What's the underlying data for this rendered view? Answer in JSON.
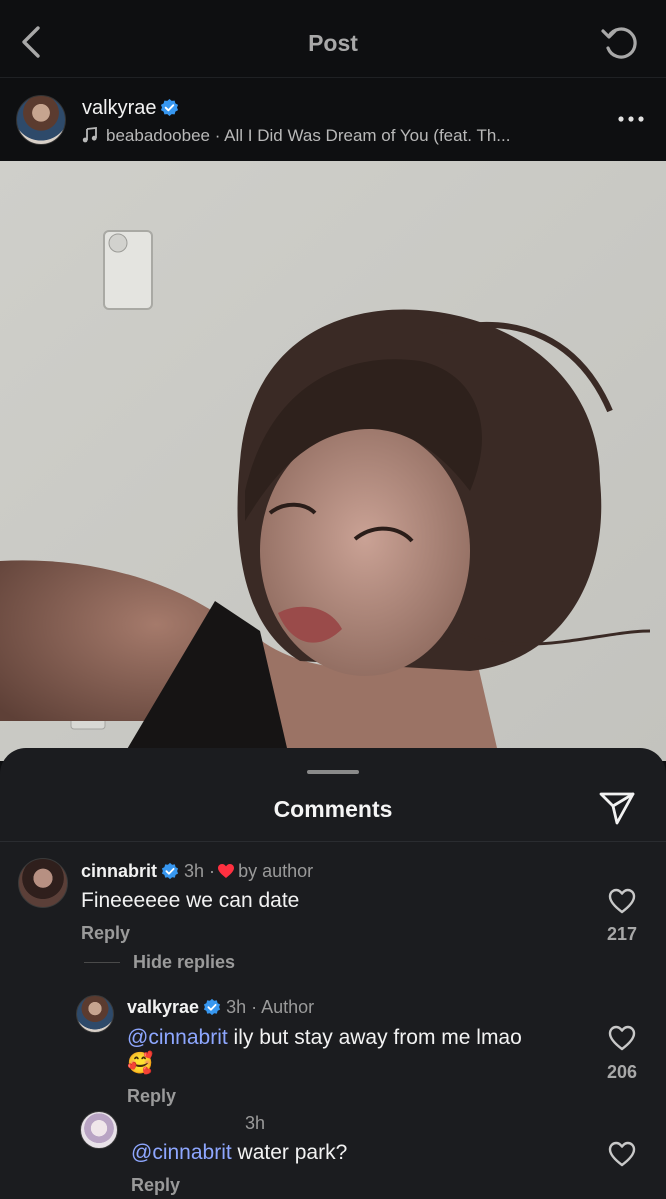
{
  "header": {
    "title": "Post"
  },
  "author": {
    "username": "valkyrae",
    "music": "beabadoobee · All I Did Was Dream of You (feat. Th..."
  },
  "comments_sheet": {
    "title": "Comments",
    "comments": [
      {
        "username": "cinnabrit",
        "time": "3h ·",
        "badge": "by author",
        "text": "Fineeeeee we can date",
        "reply_label": "Reply",
        "likes": "217",
        "hide_replies": "Hide replies"
      },
      {
        "username": "valkyrae",
        "time": "3h · Author",
        "mention": "@cinnabrit",
        "text": " ily but stay away from me lmao",
        "emoji": "🥰",
        "reply_label": "Reply",
        "likes": "206"
      },
      {
        "username": "",
        "time": "3h",
        "mention": "@cinnabrit",
        "text": " water park?",
        "reply_label": "Reply"
      }
    ]
  },
  "colors": {
    "mention": "#8ea7ff",
    "verified": "#3797f0",
    "heart_badge": "#ff3040"
  }
}
